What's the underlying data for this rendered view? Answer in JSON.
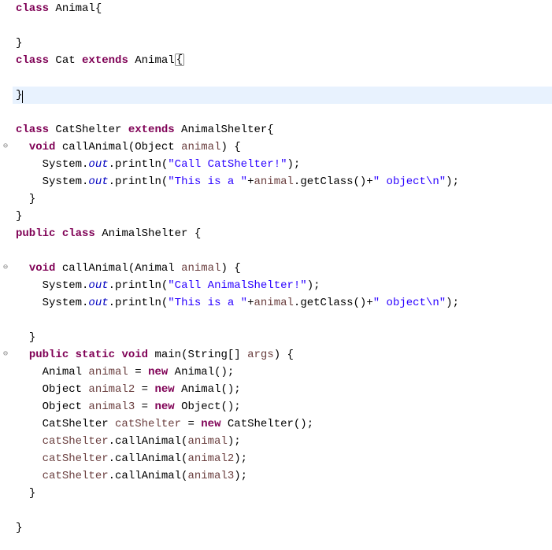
{
  "code": {
    "l1": {
      "kw1": "class",
      "t1": " Animal{"
    },
    "l2": {
      "t": ""
    },
    "l3": {
      "t": "}"
    },
    "l4": {
      "kw1": "class",
      "t1": " Cat ",
      "kw2": "extends",
      "t2": " Animal",
      "br": "{"
    },
    "l5": {
      "t": ""
    },
    "l6": {
      "t": "}"
    },
    "l7": {
      "t": ""
    },
    "l8": {
      "kw1": "class",
      "t1": " CatShelter ",
      "kw2": "extends",
      "t2": " AnimalShelter{"
    },
    "l9": {
      "i": "  ",
      "kw1": "void",
      "t1": " callAnimal(Object ",
      "p": "animal",
      "t2": ") {"
    },
    "l10": {
      "i": "    ",
      "t1": "System.",
      "fs": "out",
      "t2": ".println(",
      "s": "\"Call CatShelter!\"",
      "t3": ");"
    },
    "l11": {
      "i": "    ",
      "t1": "System.",
      "fs": "out",
      "t2": ".println(",
      "s1": "\"This is a \"",
      "t3": "+",
      "p": "animal",
      "t4": ".getClass()+",
      "s2": "\" object\\n\"",
      "t5": ");"
    },
    "l12": {
      "i": "  ",
      "t": "}"
    },
    "l13": {
      "t": "}"
    },
    "l14": {
      "kw1": "public",
      "t1": " ",
      "kw2": "class",
      "t2": " AnimalShelter {"
    },
    "l15": {
      "t": ""
    },
    "l16": {
      "i": "  ",
      "kw1": "void",
      "t1": " callAnimal(Animal ",
      "p": "animal",
      "t2": ") {"
    },
    "l17": {
      "i": "    ",
      "t1": "System.",
      "fs": "out",
      "t2": ".println(",
      "s": "\"Call AnimalShelter!\"",
      "t3": ");"
    },
    "l18": {
      "i": "    ",
      "t1": "System.",
      "fs": "out",
      "t2": ".println(",
      "s1": "\"This is a \"",
      "t3": "+",
      "p": "animal",
      "t4": ".getClass()+",
      "s2": "\" object\\n\"",
      "t5": ");"
    },
    "l19": {
      "t": ""
    },
    "l20": {
      "i": "  ",
      "t": "}"
    },
    "l21": {
      "i": "  ",
      "kw1": "public",
      "t1": " ",
      "kw2": "static",
      "t2": " ",
      "kw3": "void",
      "t3": " main(String[] ",
      "p": "args",
      "t4": ") {"
    },
    "l22": {
      "i": "    ",
      "t1": "Animal ",
      "v": "animal",
      "t2": " = ",
      "kw": "new",
      "t3": " Animal();"
    },
    "l23": {
      "i": "    ",
      "t1": "Object ",
      "v": "animal2",
      "t2": " = ",
      "kw": "new",
      "t3": " Animal();"
    },
    "l24": {
      "i": "    ",
      "t1": "Object ",
      "v": "animal3",
      "t2": " = ",
      "kw": "new",
      "t3": " Object();"
    },
    "l25": {
      "i": "    ",
      "t1": "CatShelter ",
      "v": "catShelter",
      "t2": " = ",
      "kw": "new",
      "t3": " CatShelter();"
    },
    "l26": {
      "i": "    ",
      "v1": "catShelter",
      "t1": ".callAnimal(",
      "v2": "animal",
      "t2": ");"
    },
    "l27": {
      "i": "    ",
      "v1": "catShelter",
      "t1": ".callAnimal(",
      "v2": "animal2",
      "t2": ");"
    },
    "l28": {
      "i": "    ",
      "v1": "catShelter",
      "t1": ".callAnimal(",
      "v2": "animal3",
      "t2": ");"
    },
    "l29": {
      "i": "  ",
      "t": "}"
    },
    "l30": {
      "t": ""
    },
    "l31": {
      "t": "}"
    }
  },
  "fold_glyph": "⊖"
}
